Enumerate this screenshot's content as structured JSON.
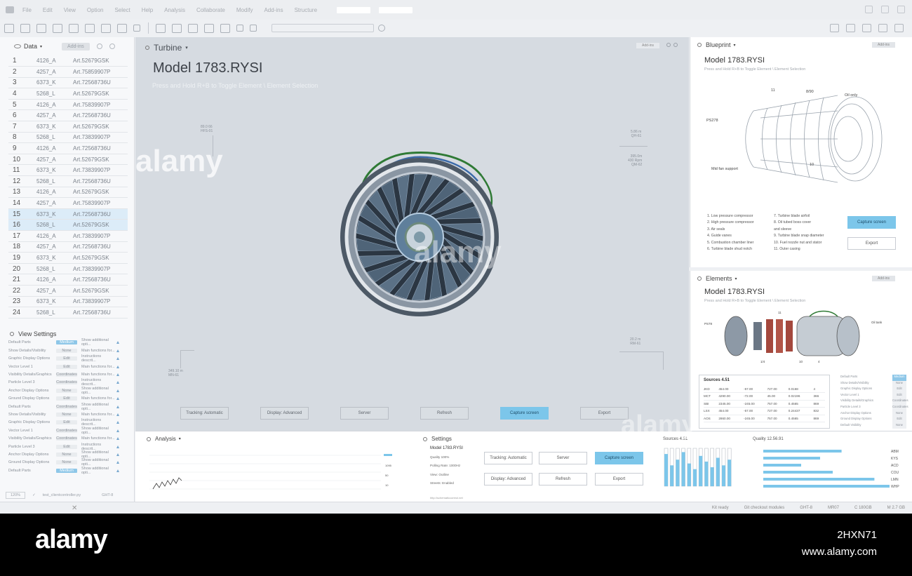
{
  "menu": [
    "File",
    "Edit",
    "View",
    "Option",
    "Select",
    "Help",
    "Analysis",
    "Collaborate",
    "Modify",
    "Add-ins",
    "Structure"
  ],
  "data_panel": {
    "title": "Data",
    "addins": "Add-ins",
    "rows": [
      {
        "n": "1",
        "code": "4126_A",
        "art": "Art.52679GSK"
      },
      {
        "n": "2",
        "code": "4257_A",
        "art": "Art.75859907P"
      },
      {
        "n": "3",
        "code": "6373_K",
        "art": "Art.72568736U"
      },
      {
        "n": "4",
        "code": "5268_L",
        "art": "Art.52679GSK"
      },
      {
        "n": "5",
        "code": "4126_A",
        "art": "Art.75839907P"
      },
      {
        "n": "6",
        "code": "4257_A",
        "art": "Art.72568736U"
      },
      {
        "n": "7",
        "code": "6373_K",
        "art": "Art.52679GSK"
      },
      {
        "n": "8",
        "code": "5268_L",
        "art": "Art.73839907P"
      },
      {
        "n": "9",
        "code": "4126_A",
        "art": "Art.72568736U"
      },
      {
        "n": "10",
        "code": "4257_A",
        "art": "Art.52679GSK"
      },
      {
        "n": "11",
        "code": "6373_K",
        "art": "Art.73839907P"
      },
      {
        "n": "12",
        "code": "5268_L",
        "art": "Art.72568736U"
      },
      {
        "n": "13",
        "code": "4126_A",
        "art": "Art.52679GSK"
      },
      {
        "n": "14",
        "code": "4257_A",
        "art": "Art.75839907P"
      },
      {
        "n": "15",
        "code": "6373_K",
        "art": "Art.72568736U"
      },
      {
        "n": "16",
        "code": "5268_L",
        "art": "Art.52679GSK"
      },
      {
        "n": "17",
        "code": "4126_A",
        "art": "Art.73839907P"
      },
      {
        "n": "18",
        "code": "4257_A",
        "art": "Art.72568736U"
      },
      {
        "n": "19",
        "code": "6373_K",
        "art": "Art.52679GSK"
      },
      {
        "n": "20",
        "code": "5268_L",
        "art": "Art.73839907P"
      },
      {
        "n": "21",
        "code": "4126_A",
        "art": "Art.72568736U"
      },
      {
        "n": "22",
        "code": "4257_A",
        "art": "Art.52679GSK"
      },
      {
        "n": "23",
        "code": "6373_K",
        "art": "Art.73839907P"
      },
      {
        "n": "24",
        "code": "5268_L",
        "art": "Art.72568736U"
      }
    ]
  },
  "view_settings": {
    "title": "View Settings",
    "rows": [
      {
        "label": "Default Parts",
        "value": "Medium",
        "desc": "Show additional opti..."
      },
      {
        "label": "Show Details/Visibility",
        "value": "None",
        "desc": "Main functions for..."
      },
      {
        "label": "Graphic Display Options",
        "value": "Edit",
        "desc": "Instructions descrit..."
      },
      {
        "label": "Vector Level 1",
        "value": "Edit",
        "desc": "Main functions for..."
      },
      {
        "label": "Visibility Details/Graphics",
        "value": "Coordinates",
        "desc": "Main functions for..."
      },
      {
        "label": "Particle Level 3",
        "value": "Coordinates",
        "desc": "Instructions descrit..."
      },
      {
        "label": "Anchor Display Options",
        "value": "None",
        "desc": "Show additional opti..."
      },
      {
        "label": "Ground Display Options",
        "value": "Edit",
        "desc": "Main functions for..."
      },
      {
        "label": "Default Parts",
        "value": "Coordinates",
        "desc": "Show additional opti..."
      },
      {
        "label": "Show Details/Visibility",
        "value": "None",
        "desc": "Main functions for..."
      },
      {
        "label": "Graphic Display Options",
        "value": "Edit",
        "desc": "Instructions descrit..."
      },
      {
        "label": "Vector Level 1",
        "value": "Coordinates",
        "desc": "Show additional opti..."
      },
      {
        "label": "Visibility Details/Graphics",
        "value": "Coordinates",
        "desc": "Main functions for..."
      },
      {
        "label": "Particle Level 3",
        "value": "Edit",
        "desc": "Instructions descrit..."
      },
      {
        "label": "Anchor Display Options",
        "value": "None",
        "desc": "Show additional opti..."
      },
      {
        "label": "Ground Display Options",
        "value": "None",
        "desc": "Show additional opti..."
      },
      {
        "label": "Default Parts",
        "value": "Medium",
        "desc": "Show additional opti..."
      }
    ],
    "footer_zoom": "120%",
    "footer_file": "test_clientcontroller.py",
    "footer_code": "GHT-8"
  },
  "viewport": {
    "tab": "Turbine",
    "title": "Model 1783.RYSI",
    "subtitle": "Press and Hold R+B to Toggle Element \\ Element Selection",
    "tag": "Add-ins",
    "note_tl": [
      "89.0 66",
      "HFS-01"
    ],
    "note_tr1": [
      "5.86 m",
      "QH-61"
    ],
    "note_tr2": [
      "395.0m",
      "430 Rpm",
      "QM-62"
    ],
    "note_bl": [
      "349.10 m",
      "MN-61"
    ],
    "note_br": [
      "20.2 m",
      "RM-61"
    ],
    "buttons": [
      "Tracking: Automatic",
      "Display: Advanced",
      "Server",
      "Refresh",
      "Capture screen",
      "Export"
    ]
  },
  "blueprint": {
    "tab": "Blueprint",
    "addins": "Add-ins",
    "title": "Model 1783.RYSI",
    "subtitle": "Press and Hold R+B to Toggle Element \\ Element Selection",
    "labels": {
      "top": "8/90",
      "oil": "Oil only",
      "ps": "PS278",
      "mid": "Mid fan support",
      "n11": "11",
      "n10": "10"
    },
    "parts_left": [
      "1.    Low pressure compressor",
      "2.    High pressure compressor",
      "3.    Air seals",
      "4.    Guide vanes",
      "5.    Combustion chamber liner",
      "6.    Turbine blade shud notch"
    ],
    "parts_right": [
      "7.    Turbine blade airfoil",
      "8.    Oil tubed boss cover",
      "       and sleeve",
      "9.    Turbine blade snap diameter",
      "10.   Fuel nozzle nut and stator",
      "11.   Outer casing"
    ],
    "capture": "Capture screen",
    "export": "Export"
  },
  "elements": {
    "tab": "Elements",
    "addins": "Add-ins",
    "title": "Model 1783.RYSI",
    "subtitle": "Press and Hold R+B to Toggle Element \\ Element Selection",
    "labels": {
      "left": "PS78",
      "right": "Oil tank",
      "b1": "1/4",
      "b2": "10",
      "b3": "4",
      "t1": "11"
    },
    "sources_title": "Sources 4.51",
    "sources": [
      [
        "JKD",
        "454.00",
        "-57.00",
        "727.00",
        "0.0168",
        "4"
      ],
      [
        "MCT",
        "4290.00",
        "-72.00",
        "45.00",
        "0.02196",
        "366"
      ],
      [
        "SBI",
        "2345.00",
        "-245.00",
        "757.00",
        "0.4565",
        "869"
      ],
      [
        "LSX",
        "454.00",
        "-57.00",
        "727.00",
        "0.24437",
        "832"
      ],
      [
        "AOS",
        "2860.00",
        "-245.00",
        "757.00",
        "0.4565",
        "869"
      ]
    ],
    "props": [
      [
        "Default Parts",
        "Medium"
      ],
      [
        "Show Details/Visibility",
        "None"
      ],
      [
        "Graphic Display Options",
        "Edit"
      ],
      [
        "Vector Level 1",
        "Edit"
      ],
      [
        "Visibility Details/Graphics",
        "Coordinates"
      ],
      [
        "Particle Level 3",
        "Coordinates"
      ],
      [
        "Anchor Display Options",
        "None"
      ],
      [
        "Ground Display Options",
        "Edit"
      ],
      [
        "Default Visibility",
        "None"
      ]
    ]
  },
  "analysis": {
    "title": "Analysis",
    "axis_labels": [
      "1095",
      "50",
      "10"
    ],
    "settings_title": "Settings",
    "settings_model": "Model 1783.RYSI",
    "settings_lines": [
      "Quality 100%",
      "Polling Rate: 1000Hz",
      "View: Outline",
      "Streets: Enabled"
    ],
    "buttons": [
      "Tracking: Automatic",
      "Server",
      "Capture screen",
      "Display: Advanced",
      "Refresh",
      "Export"
    ],
    "footer_file": "http://schematiccontrol.net",
    "sources_title": "Sources 4.51",
    "source_levels": [
      0.85,
      0.55,
      0.7,
      0.9,
      0.6,
      0.45,
      0.8,
      0.65,
      0.5,
      0.75,
      0.55,
      0.7
    ],
    "quality_title": "Quality 12.56.91",
    "quality": [
      {
        "label": "ABM",
        "value": 0.62
      },
      {
        "label": "KYS",
        "value": 0.45
      },
      {
        "label": "ACD",
        "value": 0.3
      },
      {
        "label": "COU",
        "value": 0.55
      },
      {
        "label": "LMN",
        "value": 0.88
      },
      {
        "label": "WHP",
        "value": 1.0
      }
    ]
  },
  "status": {
    "left": "Kit ready",
    "git": "Git checkout modules",
    "ght": "GHT-8",
    "mr": "MR07",
    "c": "C  180GB",
    "m": "M  2.7 GB"
  },
  "watermark": {
    "text": "alamy",
    "image_id": "2HXN71",
    "url": "www.alamy.com"
  }
}
